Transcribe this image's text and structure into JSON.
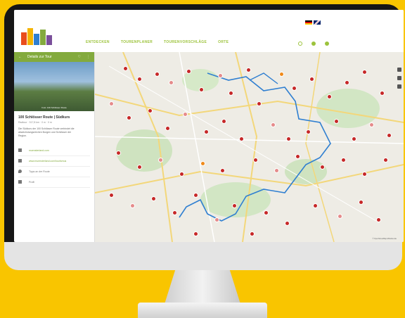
{
  "nav": {
    "items": [
      "ENTDECKEN",
      "TOURENPLANER",
      "TOURENVORSCHLÄGE",
      "ORTE"
    ]
  },
  "sidebar": {
    "header_title": "Details zur Tour",
    "photo_caption": "Foto: 100 Schlösser Route",
    "tour_title": "100 Schlösser Route | Südkurs",
    "tour_meta": "Radtour · 317,8 km · 0 m · 0 m",
    "description": "Die Südkurs der 100 Schlösser Route verbindet die abwechslungsreichen Burgen und Schlösser der Region.",
    "rows": [
      {
        "icon": "link-icon",
        "text": "muensterland.com"
      },
      {
        "icon": "link-icon",
        "text": "www.muensterland.com/tourismus"
      },
      {
        "icon": "location-icon",
        "text": "Tipps an der Route"
      },
      {
        "icon": "chart-icon",
        "text": "Profil"
      }
    ]
  },
  "map": {
    "attribution": "© OpenStreetMap-Mitwirkende"
  },
  "colors": {
    "accent": "#83aa3d",
    "marker": "#c62828",
    "route": "#2f7fd1",
    "frame": "#f9c500"
  }
}
